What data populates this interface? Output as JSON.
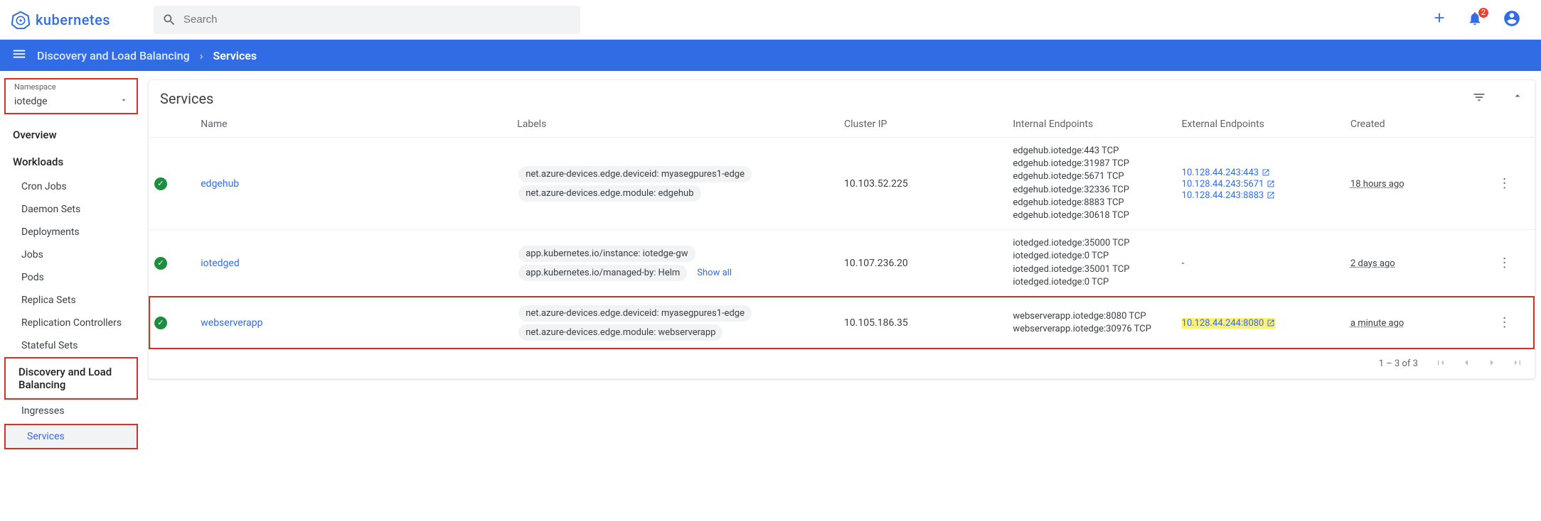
{
  "brand": "kubernetes",
  "search": {
    "placeholder": "Search"
  },
  "notifications": {
    "count": "2"
  },
  "breadcrumb": {
    "section": "Discovery and Load Balancing",
    "page": "Services"
  },
  "namespace": {
    "label": "Namespace",
    "value": "iotedge"
  },
  "sidebar": {
    "overview": "Overview",
    "workloads": "Workloads",
    "workloads_items": [
      "Cron Jobs",
      "Daemon Sets",
      "Deployments",
      "Jobs",
      "Pods",
      "Replica Sets",
      "Replication Controllers",
      "Stateful Sets"
    ],
    "dlb": "Discovery and Load Balancing",
    "dlb_items": [
      "Ingresses",
      "Services"
    ]
  },
  "card": {
    "title": "Services"
  },
  "columns": {
    "name": "Name",
    "labels": "Labels",
    "cip": "Cluster IP",
    "iep": "Internal Endpoints",
    "eep": "External Endpoints",
    "created": "Created"
  },
  "rows": [
    {
      "name": "edgehub",
      "labels": [
        "net.azure-devices.edge.deviceid: myasegpures1-edge",
        "net.azure-devices.edge.module: edgehub"
      ],
      "show_all": false,
      "cip": "10.103.52.225",
      "iep": [
        "edgehub.iotedge:443 TCP",
        "edgehub.iotedge:31987 TCP",
        "edgehub.iotedge:5671 TCP",
        "edgehub.iotedge:32336 TCP",
        "edgehub.iotedge:8883 TCP",
        "edgehub.iotedge:30618 TCP"
      ],
      "eep": [
        {
          "text": "10.128.44.243:443",
          "hl": false
        },
        {
          "text": "10.128.44.243:5671",
          "hl": false
        },
        {
          "text": "10.128.44.243:8883",
          "hl": false
        }
      ],
      "created": "18 hours ago",
      "highlight": false
    },
    {
      "name": "iotedged",
      "labels": [
        "app.kubernetes.io/instance: iotedge-gw",
        "app.kubernetes.io/managed-by: Helm"
      ],
      "show_all": true,
      "cip": "10.107.236.20",
      "iep": [
        "iotedged.iotedge:35000 TCP",
        "iotedged.iotedge:0 TCP",
        "iotedged.iotedge:35001 TCP",
        "iotedged.iotedge:0 TCP"
      ],
      "eep": [],
      "created": "2 days ago",
      "highlight": false
    },
    {
      "name": "webserverapp",
      "labels": [
        "net.azure-devices.edge.deviceid: myasegpures1-edge",
        "net.azure-devices.edge.module: webserverapp"
      ],
      "show_all": false,
      "cip": "10.105.186.35",
      "iep": [
        "webserverapp.iotedge:8080 TCP",
        "webserverapp.iotedge:30976 TCP"
      ],
      "eep": [
        {
          "text": "10.128.44.244:8080",
          "hl": true
        }
      ],
      "created": "a minute ago",
      "highlight": true
    }
  ],
  "show_all_label": "Show all",
  "pager": {
    "range": "1 – 3 of 3"
  }
}
